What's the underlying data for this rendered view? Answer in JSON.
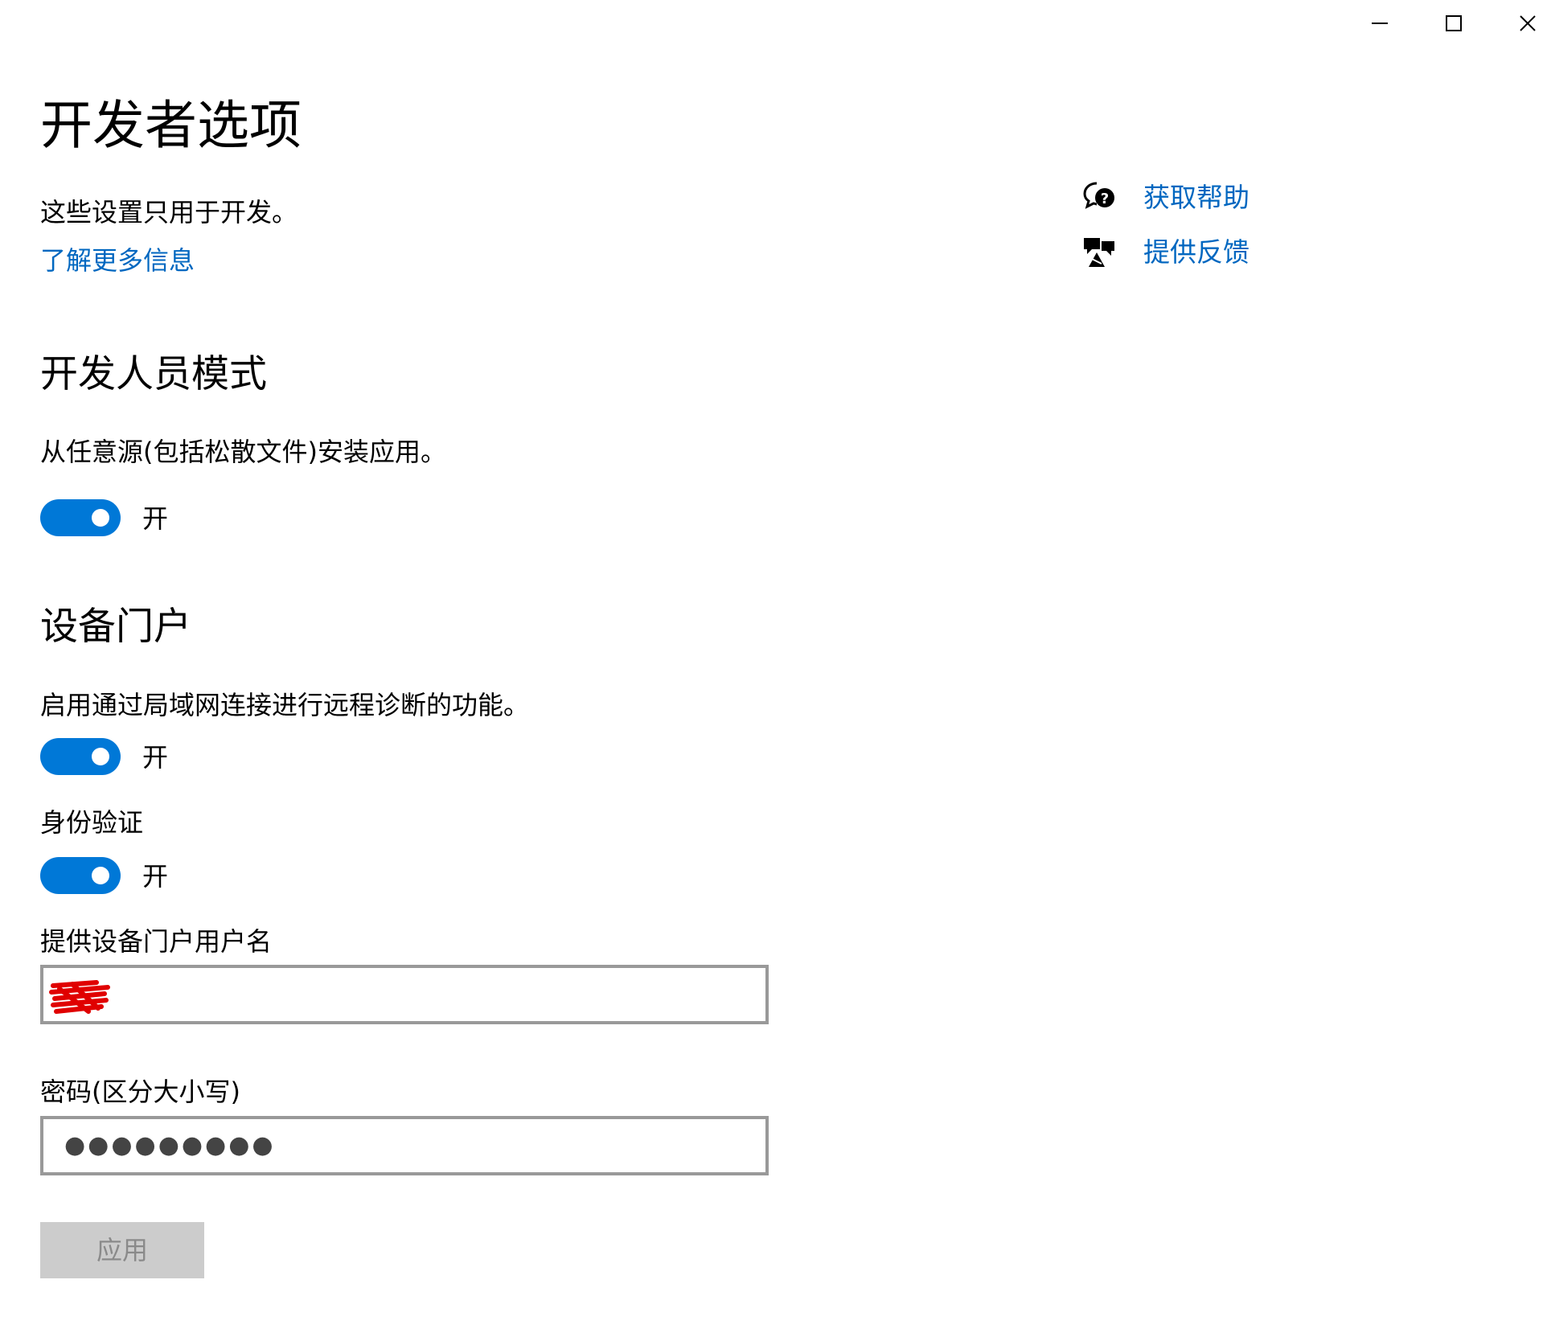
{
  "window": {
    "controls": [
      "minimize-icon",
      "maximize-icon",
      "close-icon"
    ]
  },
  "page": {
    "title": "开发者选项",
    "description": "这些设置只用于开发。",
    "learn_more_link": "了解更多信息"
  },
  "side_links": {
    "get_help": "获取帮助",
    "give_feedback": "提供反馈"
  },
  "developer_mode": {
    "heading": "开发人员模式",
    "description": "从任意源(包括松散文件)安装应用。",
    "toggle_on": true,
    "toggle_label": "开"
  },
  "device_portal": {
    "heading": "设备门户",
    "description": "启用通过局域网连接进行远程诊断的功能。",
    "toggle_on": true,
    "toggle_label": "开",
    "auth_label": "身份验证",
    "auth_toggle_on": true,
    "auth_toggle_label": "开",
    "username_label": "提供设备门户用户名",
    "username_value": "",
    "password_label": "密码(区分大小写)",
    "password_value": "●●●●●●●●●",
    "apply_label": "应用"
  },
  "colors": {
    "accent": "#0078d7",
    "link": "#0067c0",
    "textbox_border": "#999999",
    "apply_disabled_bg": "#cccccc",
    "redaction": "#e00000"
  }
}
